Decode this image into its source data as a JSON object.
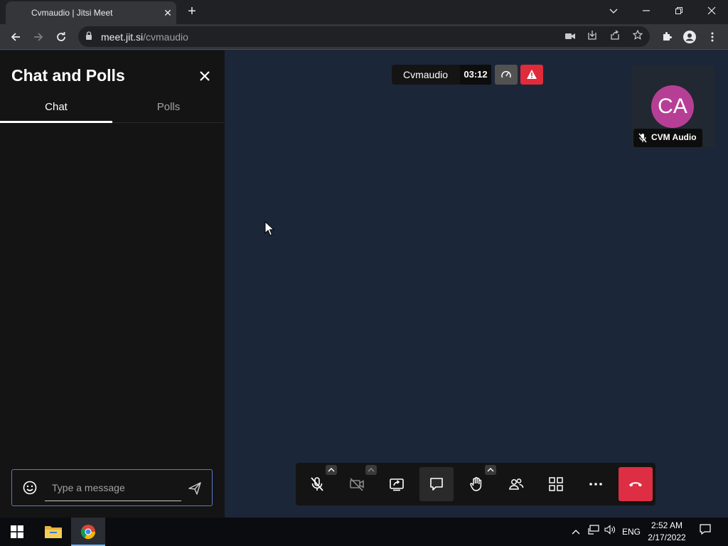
{
  "browser": {
    "tab_title": "Cvmaudio | Jitsi Meet",
    "url_host": "meet.jit.si",
    "url_path": "/cvmaudio"
  },
  "chat_panel": {
    "title": "Chat and Polls",
    "tabs": [
      {
        "label": "Chat",
        "active": true
      },
      {
        "label": "Polls",
        "active": false
      }
    ],
    "input_placeholder": "Type a message"
  },
  "meeting": {
    "subject": "Cvmaudio",
    "timer": "03:12",
    "participant": {
      "initials": "CA",
      "name": "CVM Audio",
      "avatar_color": "#b63f95",
      "muted": true
    }
  },
  "toolbox": {
    "buttons": [
      {
        "name": "microphone-muted",
        "has_menu": true
      },
      {
        "name": "camera-off",
        "has_menu": true
      },
      {
        "name": "screen-share",
        "has_menu": false
      },
      {
        "name": "chat",
        "has_menu": false,
        "active": true
      },
      {
        "name": "raise-hand",
        "has_menu": true
      },
      {
        "name": "participants",
        "has_menu": false
      },
      {
        "name": "tile-view",
        "has_menu": false
      },
      {
        "name": "more-actions",
        "has_menu": false
      },
      {
        "name": "hang-up",
        "has_menu": false
      }
    ],
    "hangup_color": "#dd2e44"
  },
  "taskbar": {
    "language": "ENG",
    "time": "2:52 AM",
    "date": "2/17/2022"
  },
  "colors": {
    "stage_bg": "#1c2639",
    "panel_bg": "#141414",
    "accent_input": "#5a79c8",
    "warning": "#e02b3a"
  }
}
